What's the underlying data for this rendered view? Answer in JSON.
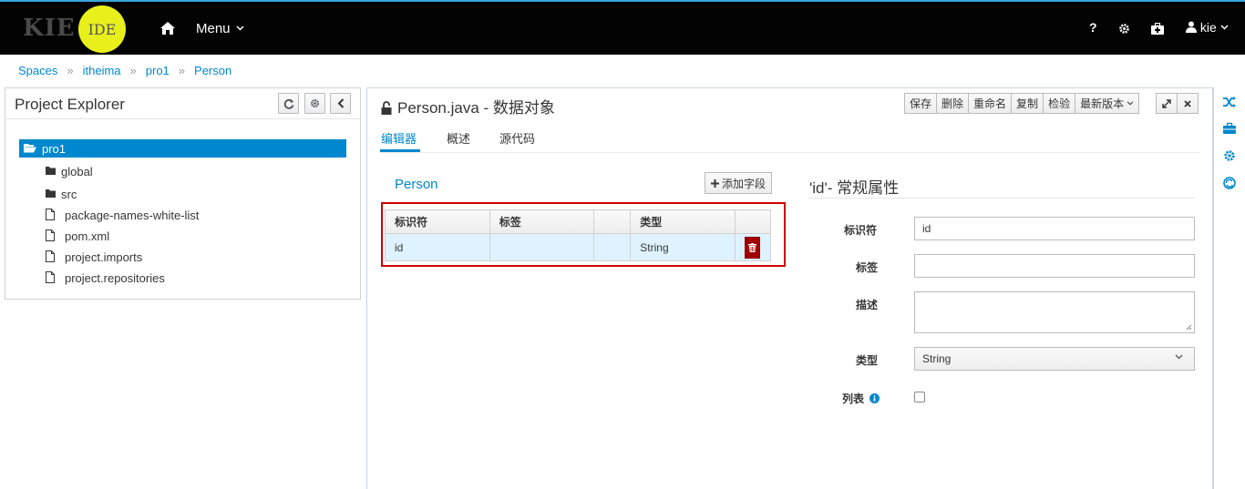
{
  "topbar": {
    "logo_text": "KIE",
    "logo_badge": "IDE",
    "menu_label": "Menu",
    "help_label": "?",
    "user_label": "kie",
    "icons": [
      "home-icon",
      "chevron-down-icon",
      "help-icon",
      "gear-icon",
      "briefcase-icon",
      "user-icon"
    ]
  },
  "breadcrumb": [
    "Spaces",
    "itheima",
    "pro1",
    "Person"
  ],
  "breadcrumb_sep": "»",
  "project_explorer": {
    "title": "Project Explorer",
    "root": "pro1",
    "items": [
      {
        "label": "global",
        "type": "folder"
      },
      {
        "label": "src",
        "type": "folder"
      },
      {
        "label": "package-names-white-list",
        "type": "file"
      },
      {
        "label": "pom.xml",
        "type": "file"
      },
      {
        "label": "project.imports",
        "type": "file"
      },
      {
        "label": "project.repositories",
        "type": "file"
      }
    ]
  },
  "editor": {
    "title": "Person.java - 数据对象",
    "toolbar": [
      "保存",
      "删除",
      "重命名",
      "复制",
      "检验",
      "最新版本"
    ],
    "tabs": [
      "编辑器",
      "概述",
      "源代码"
    ],
    "active_tab": "编辑器",
    "section_title": "Person",
    "add_field_label": "添加字段",
    "table": {
      "headers": [
        "标识符",
        "标签",
        "",
        "类型",
        ""
      ],
      "rows": [
        {
          "identifier": "id",
          "label": "",
          "extra": "",
          "type": "String"
        }
      ]
    },
    "properties": {
      "title": "'id'- 常规属性",
      "identifier_label": "标识符",
      "identifier_value": "id",
      "label_label": "标签",
      "label_value": "",
      "description_label": "描述",
      "description_value": "",
      "type_label": "类型",
      "type_value": "String",
      "list_label": "列表",
      "list_checked": false
    }
  },
  "colors": {
    "accent": "#0088ce",
    "topbar_bg": "#030303",
    "selection_bg": "#def3ff",
    "danger": "#a30000",
    "highlight_box": "#cc0000",
    "logo_badge": "#e8f01c"
  }
}
